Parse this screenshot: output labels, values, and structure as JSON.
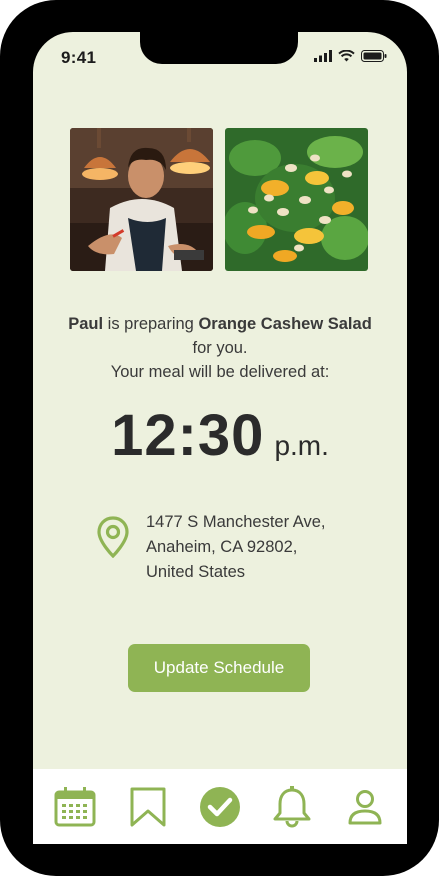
{
  "status_bar": {
    "time": "9:41"
  },
  "photos": {
    "left": "chef-photo",
    "right": "salad-photo"
  },
  "message": {
    "chef_name": "Paul",
    "preparing_text": " is preparing ",
    "dish_name": "Orange Cashew Salad",
    "for_you": "for you.",
    "delivered_text": "Your meal will be delivered at:"
  },
  "delivery": {
    "time": "12:30",
    "ampm": "p.m."
  },
  "address": {
    "line1": "1477 S Manchester Ave,",
    "line2": "Anaheim, CA 92802,",
    "line3": "United States"
  },
  "update_button": {
    "label": "Update Schedule"
  },
  "tabbar": {
    "items": [
      "calendar-icon",
      "bookmark-icon",
      "check-icon",
      "bell-icon",
      "profile-icon"
    ],
    "active": "check-icon"
  },
  "colors": {
    "accent": "#8fb454",
    "background": "#edf1de",
    "text": "#3a3a3a"
  }
}
